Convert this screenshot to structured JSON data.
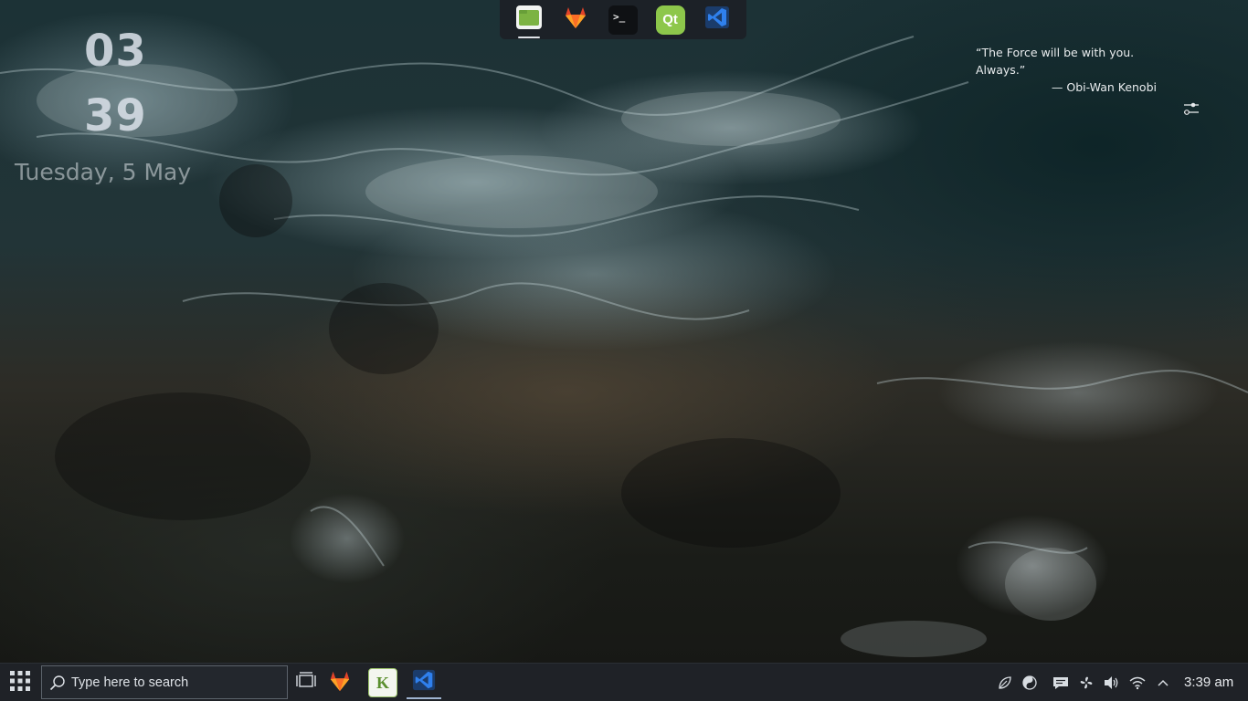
{
  "desktop": {
    "wallpaper": "aerial-ocean-waves-on-rocks",
    "clock_widget": {
      "hours": "03",
      "minutes": "39",
      "date": "Tuesday, 5 May"
    },
    "quote_widget": {
      "text": "“The Force will be with you. Always.”",
      "author": "— Obi-Wan Kenobi"
    },
    "settings_icon": "sliders-toggle-icon"
  },
  "dock": {
    "apps": [
      {
        "name": "files",
        "icon": "folder-icon",
        "color": "#8bc34a"
      },
      {
        "name": "gitlab",
        "icon": "gitlab-fox-icon",
        "color": "#fc6d26"
      },
      {
        "name": "terminal",
        "icon": "terminal-icon",
        "label": ">_"
      },
      {
        "name": "qt-creator",
        "icon": "qt-icon",
        "label": "Qt",
        "color": "#8dc74b"
      },
      {
        "name": "vscode",
        "icon": "vscode-icon",
        "color": "#1f6fd0"
      }
    ]
  },
  "taskbar": {
    "start_icon": "app-grid-icon",
    "search": {
      "placeholder": "Type here to search",
      "icon": "search-icon"
    },
    "task_view_icon": "task-view-icon",
    "pinned": [
      {
        "name": "gitlab",
        "icon": "gitlab-fox-icon"
      },
      {
        "name": "kile",
        "icon": "kile-icon",
        "label": "K"
      },
      {
        "name": "vscode",
        "icon": "vscode-icon"
      }
    ],
    "tray": [
      "leaf-icon",
      "yin-yang-icon",
      "chat-bubble-icon",
      "fan-icon",
      "speaker-icon",
      "wifi-icon",
      "chevron-up-icon"
    ],
    "clock": "3:39 am"
  }
}
